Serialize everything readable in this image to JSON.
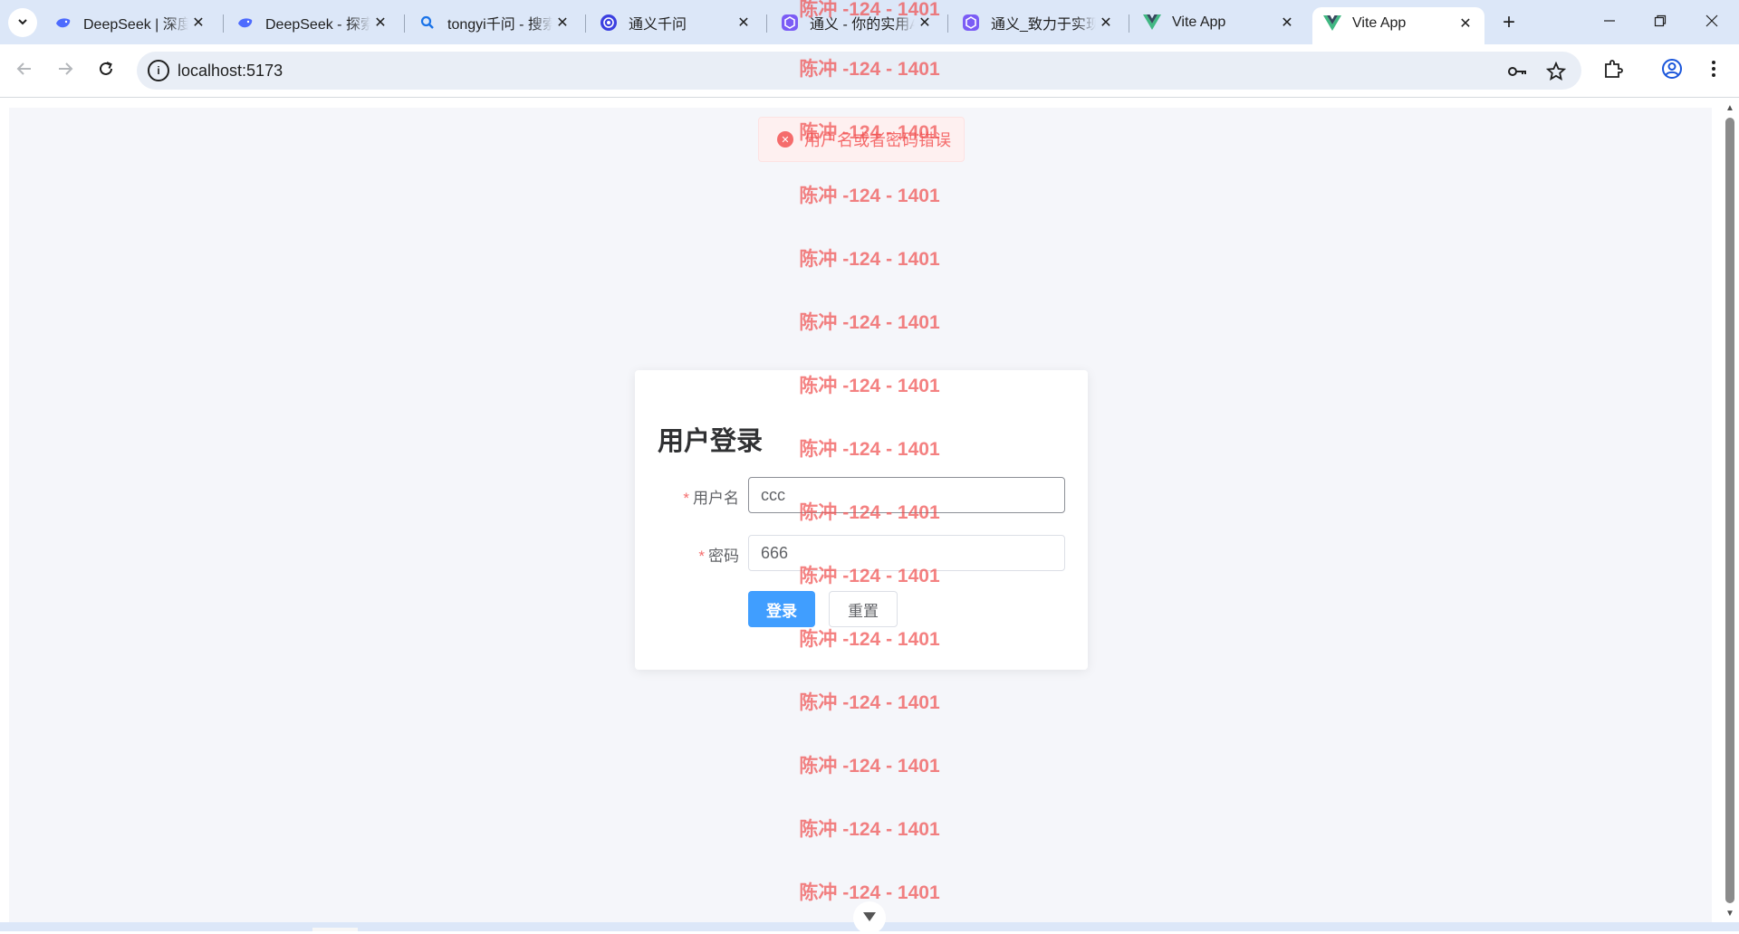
{
  "browser": {
    "tabs": [
      {
        "title": "DeepSeek | 深度求索",
        "icon": "deepseek-whale-icon"
      },
      {
        "title": "DeepSeek - 探索未至之境",
        "icon": "deepseek-whale-icon"
      },
      {
        "title": "tongyi千问 - 搜索",
        "icon": "search-icon"
      },
      {
        "title": "通义千问",
        "icon": "tongyi-icon"
      },
      {
        "title": "通义 - 你的实用AI助手",
        "icon": "tongyi-app-icon"
      },
      {
        "title": "通义_致力于实现",
        "icon": "tongyi-app-icon"
      },
      {
        "title": "Vite App",
        "icon": "vue-icon"
      },
      {
        "title": "Vite App",
        "icon": "vue-icon",
        "active": true
      }
    ],
    "url": "localhost:5173"
  },
  "message": {
    "type": "error",
    "text": "用户名或者密码错误"
  },
  "login": {
    "title": "用户登录",
    "username_label": "用户名",
    "username_value": "ccc",
    "password_label": "密码",
    "password_value": "666",
    "required_mark": "*",
    "submit_label": "登录",
    "reset_label": "重置"
  },
  "watermark": {
    "text": "陈冲 -124 - 1401"
  },
  "colors": {
    "primary": "#409eff",
    "error": "#f56c6c",
    "watermark": "#f05050",
    "page_bg": "#f5f6fa"
  }
}
